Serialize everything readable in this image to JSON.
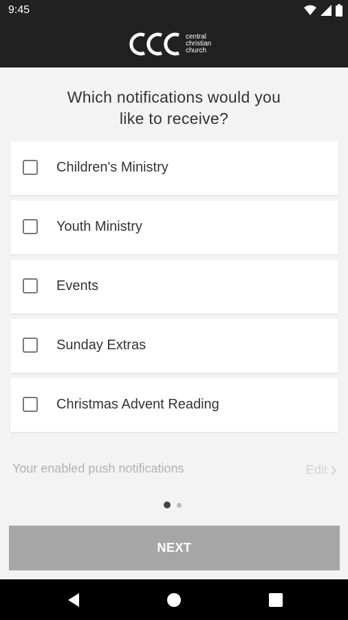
{
  "status_bar": {
    "time": "9:45"
  },
  "brand": {
    "logo_line1": "central",
    "logo_line2": "christian",
    "logo_line3": "church"
  },
  "question": {
    "line1": "Which notifications would you",
    "line2": "like to receive?"
  },
  "options": [
    {
      "label": "Children's Ministry",
      "checked": false
    },
    {
      "label": "Youth Ministry",
      "checked": false
    },
    {
      "label": "Events",
      "checked": false
    },
    {
      "label": "Sunday Extras",
      "checked": false
    },
    {
      "label": "Christmas Advent Reading",
      "checked": false
    }
  ],
  "footer": {
    "enabled_label": "Your enabled push notifications",
    "edit_label": "Edit"
  },
  "pager": {
    "current": 1,
    "total": 2
  },
  "next_button": {
    "label": "NEXT"
  },
  "colors": {
    "header_bg": "#212121",
    "button_bg": "#a6a6a6",
    "page_bg": "#f3f3f3"
  }
}
